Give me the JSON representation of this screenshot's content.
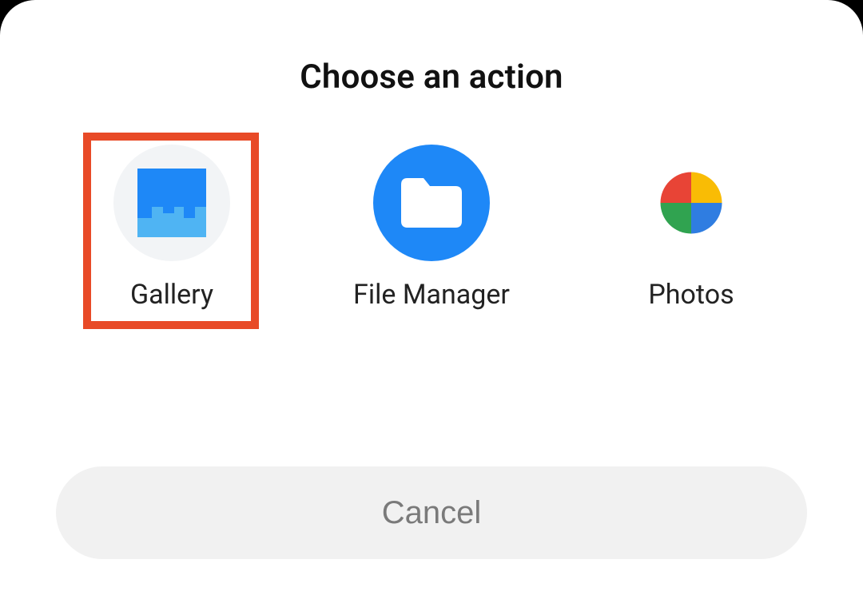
{
  "dialog": {
    "title": "Choose an action",
    "options": [
      {
        "id": "gallery",
        "label": "Gallery",
        "highlighted": true
      },
      {
        "id": "file-manager",
        "label": "File Manager",
        "highlighted": false
      },
      {
        "id": "photos",
        "label": "Photos",
        "highlighted": false
      }
    ],
    "cancel_label": "Cancel"
  },
  "colors": {
    "highlight_border": "#E84A27",
    "file_manager_circle": "#1E88F7",
    "gallery_circle": "#F2F4F6",
    "cancel_bg": "#F1F1F1",
    "cancel_text": "#7A7A7A"
  }
}
